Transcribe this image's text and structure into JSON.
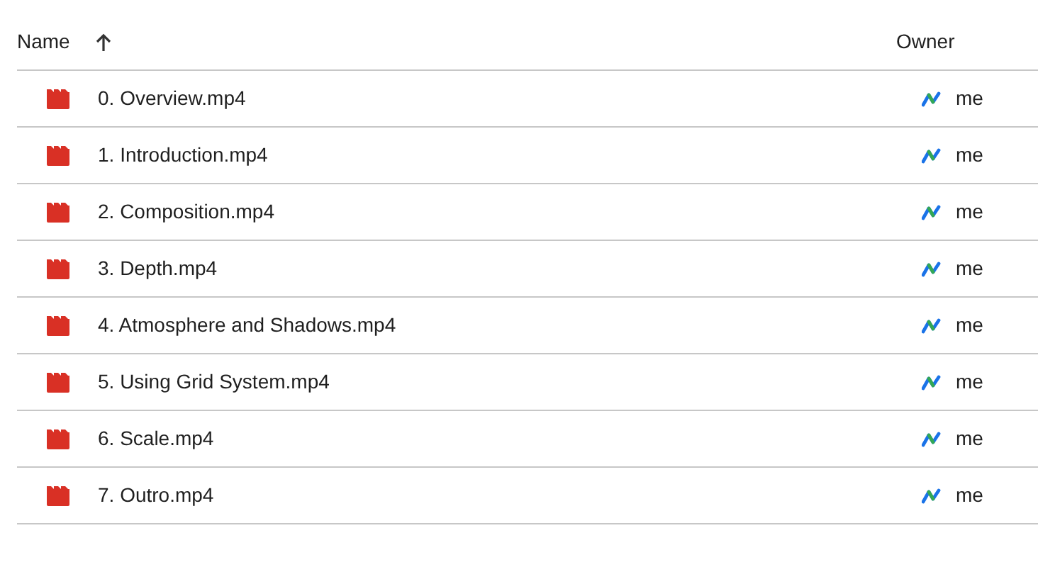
{
  "columns": [
    {
      "label": "Name",
      "sorted": true
    },
    {
      "label": "Owner",
      "sorted": false
    }
  ],
  "rows": [
    {
      "name": "0. Overview.mp4",
      "owner": "me"
    },
    {
      "name": "1. Introduction.mp4",
      "owner": "me"
    },
    {
      "name": "2. Composition.mp4",
      "owner": "me"
    },
    {
      "name": "3. Depth.mp4",
      "owner": "me"
    },
    {
      "name": "4. Atmosphere and Shadows.mp4",
      "owner": "me"
    },
    {
      "name": "5. Using Grid System.mp4",
      "owner": "me"
    },
    {
      "name": "6. Scale.mp4",
      "owner": "me"
    },
    {
      "name": "7. Outro.mp4",
      "owner": "me"
    }
  ]
}
